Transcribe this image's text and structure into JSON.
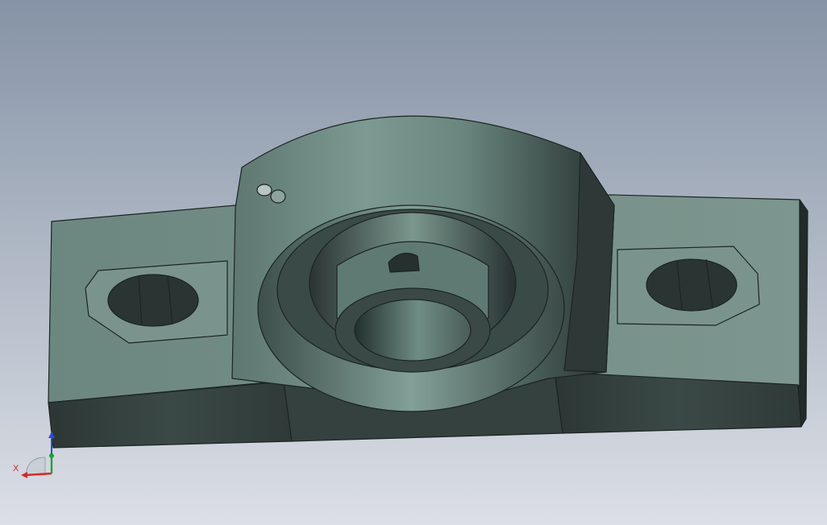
{
  "viewport": {
    "background_top": "#8a98ab",
    "background_bottom": "#d9dde4",
    "model_color": "#6e8c84",
    "model_dark": "#34423f",
    "edge_color": "#1c2422"
  },
  "triad": {
    "x_label": "X",
    "x_color": "#d62828",
    "y_color": "#22a038",
    "z_color": "#2a4ed6"
  }
}
